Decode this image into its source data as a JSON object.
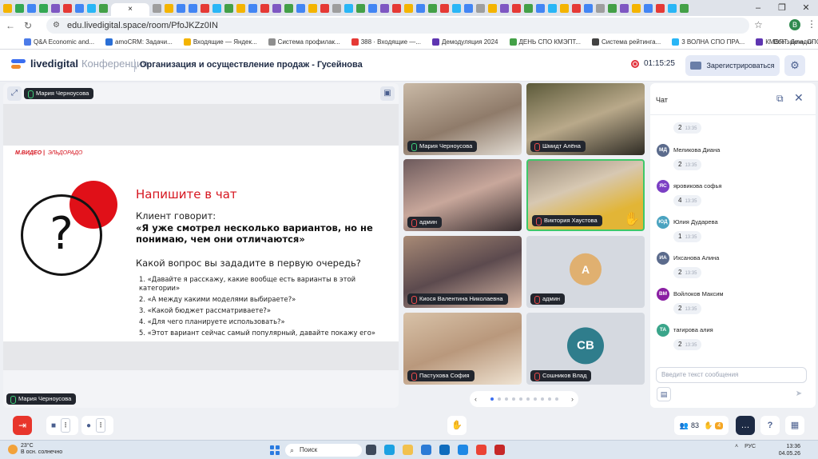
{
  "browser": {
    "active_tab_close": "×",
    "url": "edu.livedigital.space/room/PfoJKZz0IN",
    "profile_initial": "В",
    "bookmarks": [
      {
        "label": "Q&A Economic and...",
        "color": "#4c7be8"
      },
      {
        "label": "amoCRM: Задачи...",
        "color": "#2a6fd6"
      },
      {
        "label": "Входящие — Яндек...",
        "color": "#f4b400"
      },
      {
        "label": "Система профилак...",
        "color": "#8e8e8e"
      },
      {
        "label": "388 · Входящие —...",
        "color": "#e53935"
      },
      {
        "label": "Демодуляция 2024",
        "color": "#5e35b1"
      },
      {
        "label": "ДЕНЬ СПО КМЭПТ...",
        "color": "#43a047"
      },
      {
        "label": "Система рейтинга...",
        "color": "#424242"
      },
      {
        "label": "3 ВОЛНА СПО ПРА...",
        "color": "#29b6f6"
      },
      {
        "label": "КМЭПТ. День СПО...",
        "color": "#5e35b1"
      }
    ],
    "all_bookmarks": "Все закладки"
  },
  "app": {
    "logo": "livedigital",
    "logo_suffix": "Конференция",
    "room_title": "Организация и осуществление продаж - Гусейнова",
    "timer": "01:15:25",
    "register_label": "Зарегистрироваться"
  },
  "stage": {
    "presenter": "Мария Черноусова",
    "slide": {
      "brand": "М.ВИДЕО | ЭЛЬДОРАДО",
      "brand_accent": "ЭЛЬДОРАДО",
      "question_mark": "?",
      "heading": "Напишите в чат",
      "client_says": "Клиент говорит:",
      "quote": "«Я уже смотрел несколько вариантов, но не понимаю, чем они отличаются»",
      "question": "Какой вопрос вы зададите в первую очередь?",
      "options": [
        "1. «Давайте я расскажу, какие вообще есть варианты в этой категории»",
        "2. «А между какими моделями выбираете?»",
        "3. «Какой бюджет рассматриваете?»",
        "4. «Для чего планируете использовать?»",
        "5. «Этот вариант сейчас самый популярный, давайте покажу его»"
      ]
    },
    "speaker_label": "Мария Черноусова"
  },
  "participants": [
    {
      "name": "Мария Черноусова",
      "muted": false
    },
    {
      "name": "Шмидт Алёна",
      "muted": true
    },
    {
      "name": "админ",
      "muted": true
    },
    {
      "name": "Виктория Хаустова",
      "muted": true,
      "hand_raised": true
    },
    {
      "name": "Киося Валентина Николаевна",
      "muted": true
    },
    {
      "name": "админ",
      "muted": true,
      "initials": "А"
    },
    {
      "name": "Пастухова София",
      "muted": true
    },
    {
      "name": "Сошников Влад",
      "muted": true,
      "initials": "СВ"
    }
  ],
  "pager": {
    "prev": "‹",
    "next": "›",
    "pages": 10,
    "current": 1
  },
  "chat": {
    "title": "Чат",
    "messages": [
      {
        "initials": "",
        "name": "",
        "text": "2",
        "time": "13:35",
        "color": ""
      },
      {
        "initials": "МД",
        "name": "Меликова Диана",
        "text": "2",
        "time": "13:35",
        "color": "#5b6b8c"
      },
      {
        "initials": "ЯС",
        "name": "яровикова софья",
        "text": "4",
        "time": "13:35",
        "color": "#7b3fc4"
      },
      {
        "initials": "ЮД",
        "name": "Юлия Дударева",
        "text": "1",
        "time": "13:35",
        "color": "#4aa3c0"
      },
      {
        "initials": "ИА",
        "name": "Ихсанова Алина",
        "text": "2",
        "time": "13:35",
        "color": "#5b6b8c"
      },
      {
        "initials": "ВМ",
        "name": "Войлоков Максим",
        "text": "2",
        "time": "13:35",
        "color": "#8a1fa3"
      },
      {
        "initials": "ТА",
        "name": "тагирова алия",
        "text": "2",
        "time": "13:35",
        "color": "#3aa58a"
      }
    ],
    "input_placeholder": "Введите текст сообщения"
  },
  "toolbar": {
    "participants_count": "83",
    "hands_count": "4"
  },
  "taskbar": {
    "temperature": "23°C",
    "weather_desc": "В осн. солнечно",
    "search_label": "Поиск",
    "lang": "РУС",
    "time": "13:36",
    "date": "04.05.26"
  },
  "colors": {
    "accent": "#3b6ef0",
    "danger": "#e8352b",
    "slide_red": "#d6151f",
    "dark": "#1d2a44"
  }
}
